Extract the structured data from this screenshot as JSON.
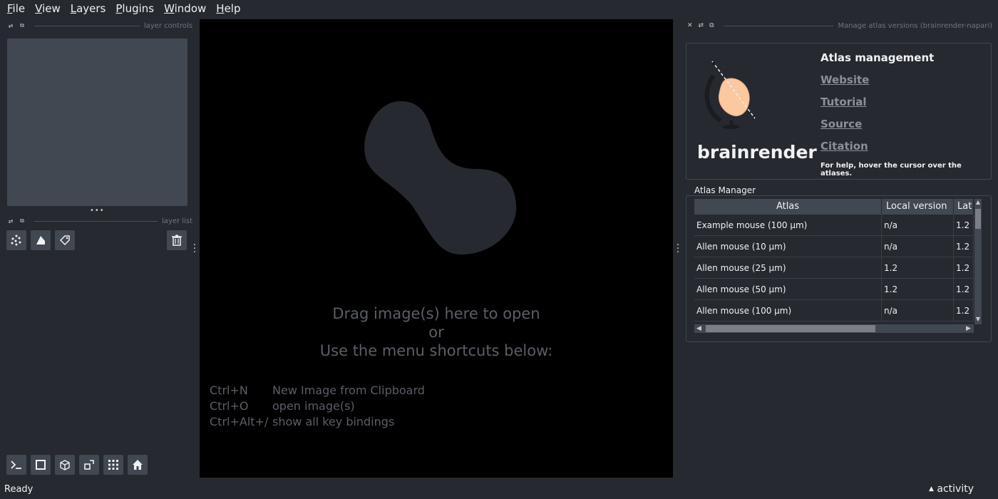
{
  "menu": [
    "File",
    "View",
    "Layers",
    "Plugins",
    "Window",
    "Help"
  ],
  "menu_mnemonic": [
    "F",
    "V",
    "L",
    "P",
    "W",
    "H"
  ],
  "left_dock": {
    "controls_title": "layer controls",
    "list_title": "layer list"
  },
  "canvas": {
    "line1": "Drag image(s) here to open",
    "line2": "or",
    "line3": "Use the menu shortcuts below:",
    "shortcuts": [
      {
        "key": "Ctrl+N",
        "action": "New Image from Clipboard"
      },
      {
        "key": "Ctrl+O",
        "action": "open image(s)"
      },
      {
        "key": "Ctrl+Alt+/",
        "action": "show all key bindings"
      }
    ]
  },
  "right_dock": {
    "title": "Manage atlas versions (brainrender-napari)",
    "brand": "brainrender",
    "header_title": "Atlas management",
    "links": [
      "Website",
      "Tutorial",
      "Source",
      "Citation"
    ],
    "help": "For help, hover the cursor over the atlases.",
    "group_label": "Atlas Manager",
    "table": {
      "columns": [
        "Atlas",
        "Local version",
        "Lat"
      ],
      "rows": [
        [
          "Example mouse (100 μm)",
          "n/a",
          "1.2"
        ],
        [
          "Allen mouse (10 μm)",
          "n/a",
          "1.2"
        ],
        [
          "Allen mouse (25 μm)",
          "1.2",
          "1.2"
        ],
        [
          "Allen mouse (50 μm)",
          "1.2",
          "1.2"
        ],
        [
          "Allen mouse (100 μm)",
          "n/a",
          "1.2"
        ]
      ]
    }
  },
  "status": {
    "text": "Ready",
    "activity": "activity"
  },
  "colors": {
    "background": "#262930",
    "panel": "#414851",
    "canvas": "#000000",
    "muted_text": "#5a5e66"
  }
}
